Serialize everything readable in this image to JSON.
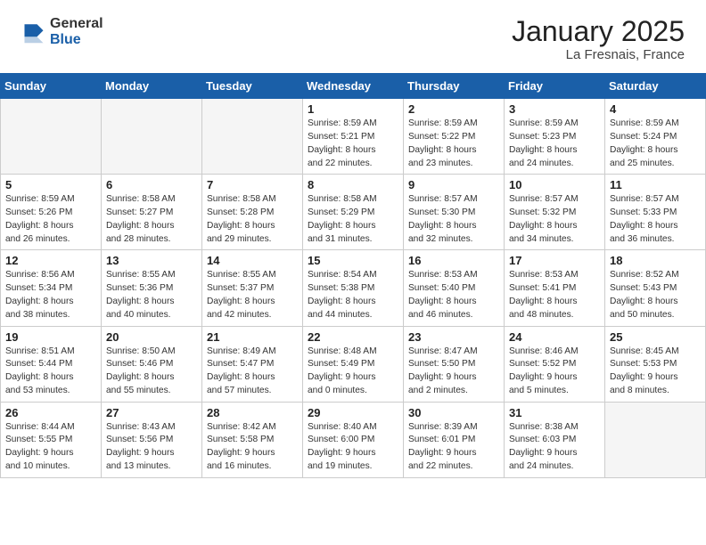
{
  "logo": {
    "general": "General",
    "blue": "Blue"
  },
  "title": "January 2025",
  "subtitle": "La Fresnais, France",
  "days_header": [
    "Sunday",
    "Monday",
    "Tuesday",
    "Wednesday",
    "Thursday",
    "Friday",
    "Saturday"
  ],
  "weeks": [
    [
      {
        "num": "",
        "info": ""
      },
      {
        "num": "",
        "info": ""
      },
      {
        "num": "",
        "info": ""
      },
      {
        "num": "1",
        "info": "Sunrise: 8:59 AM\nSunset: 5:21 PM\nDaylight: 8 hours\nand 22 minutes."
      },
      {
        "num": "2",
        "info": "Sunrise: 8:59 AM\nSunset: 5:22 PM\nDaylight: 8 hours\nand 23 minutes."
      },
      {
        "num": "3",
        "info": "Sunrise: 8:59 AM\nSunset: 5:23 PM\nDaylight: 8 hours\nand 24 minutes."
      },
      {
        "num": "4",
        "info": "Sunrise: 8:59 AM\nSunset: 5:24 PM\nDaylight: 8 hours\nand 25 minutes."
      }
    ],
    [
      {
        "num": "5",
        "info": "Sunrise: 8:59 AM\nSunset: 5:26 PM\nDaylight: 8 hours\nand 26 minutes."
      },
      {
        "num": "6",
        "info": "Sunrise: 8:58 AM\nSunset: 5:27 PM\nDaylight: 8 hours\nand 28 minutes."
      },
      {
        "num": "7",
        "info": "Sunrise: 8:58 AM\nSunset: 5:28 PM\nDaylight: 8 hours\nand 29 minutes."
      },
      {
        "num": "8",
        "info": "Sunrise: 8:58 AM\nSunset: 5:29 PM\nDaylight: 8 hours\nand 31 minutes."
      },
      {
        "num": "9",
        "info": "Sunrise: 8:57 AM\nSunset: 5:30 PM\nDaylight: 8 hours\nand 32 minutes."
      },
      {
        "num": "10",
        "info": "Sunrise: 8:57 AM\nSunset: 5:32 PM\nDaylight: 8 hours\nand 34 minutes."
      },
      {
        "num": "11",
        "info": "Sunrise: 8:57 AM\nSunset: 5:33 PM\nDaylight: 8 hours\nand 36 minutes."
      }
    ],
    [
      {
        "num": "12",
        "info": "Sunrise: 8:56 AM\nSunset: 5:34 PM\nDaylight: 8 hours\nand 38 minutes."
      },
      {
        "num": "13",
        "info": "Sunrise: 8:55 AM\nSunset: 5:36 PM\nDaylight: 8 hours\nand 40 minutes."
      },
      {
        "num": "14",
        "info": "Sunrise: 8:55 AM\nSunset: 5:37 PM\nDaylight: 8 hours\nand 42 minutes."
      },
      {
        "num": "15",
        "info": "Sunrise: 8:54 AM\nSunset: 5:38 PM\nDaylight: 8 hours\nand 44 minutes."
      },
      {
        "num": "16",
        "info": "Sunrise: 8:53 AM\nSunset: 5:40 PM\nDaylight: 8 hours\nand 46 minutes."
      },
      {
        "num": "17",
        "info": "Sunrise: 8:53 AM\nSunset: 5:41 PM\nDaylight: 8 hours\nand 48 minutes."
      },
      {
        "num": "18",
        "info": "Sunrise: 8:52 AM\nSunset: 5:43 PM\nDaylight: 8 hours\nand 50 minutes."
      }
    ],
    [
      {
        "num": "19",
        "info": "Sunrise: 8:51 AM\nSunset: 5:44 PM\nDaylight: 8 hours\nand 53 minutes."
      },
      {
        "num": "20",
        "info": "Sunrise: 8:50 AM\nSunset: 5:46 PM\nDaylight: 8 hours\nand 55 minutes."
      },
      {
        "num": "21",
        "info": "Sunrise: 8:49 AM\nSunset: 5:47 PM\nDaylight: 8 hours\nand 57 minutes."
      },
      {
        "num": "22",
        "info": "Sunrise: 8:48 AM\nSunset: 5:49 PM\nDaylight: 9 hours\nand 0 minutes."
      },
      {
        "num": "23",
        "info": "Sunrise: 8:47 AM\nSunset: 5:50 PM\nDaylight: 9 hours\nand 2 minutes."
      },
      {
        "num": "24",
        "info": "Sunrise: 8:46 AM\nSunset: 5:52 PM\nDaylight: 9 hours\nand 5 minutes."
      },
      {
        "num": "25",
        "info": "Sunrise: 8:45 AM\nSunset: 5:53 PM\nDaylight: 9 hours\nand 8 minutes."
      }
    ],
    [
      {
        "num": "26",
        "info": "Sunrise: 8:44 AM\nSunset: 5:55 PM\nDaylight: 9 hours\nand 10 minutes."
      },
      {
        "num": "27",
        "info": "Sunrise: 8:43 AM\nSunset: 5:56 PM\nDaylight: 9 hours\nand 13 minutes."
      },
      {
        "num": "28",
        "info": "Sunrise: 8:42 AM\nSunset: 5:58 PM\nDaylight: 9 hours\nand 16 minutes."
      },
      {
        "num": "29",
        "info": "Sunrise: 8:40 AM\nSunset: 6:00 PM\nDaylight: 9 hours\nand 19 minutes."
      },
      {
        "num": "30",
        "info": "Sunrise: 8:39 AM\nSunset: 6:01 PM\nDaylight: 9 hours\nand 22 minutes."
      },
      {
        "num": "31",
        "info": "Sunrise: 8:38 AM\nSunset: 6:03 PM\nDaylight: 9 hours\nand 24 minutes."
      },
      {
        "num": "",
        "info": ""
      }
    ]
  ]
}
